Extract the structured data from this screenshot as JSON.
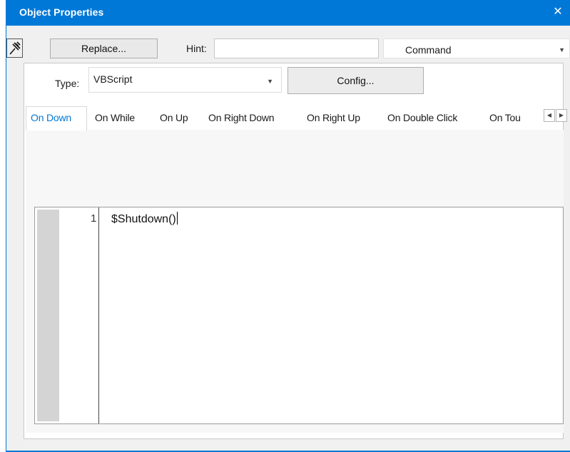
{
  "window": {
    "title": "Object Properties",
    "close_glyph": "✕"
  },
  "toolbar": {
    "pin_icon": "pin-icon",
    "replace_label": "Replace...",
    "hint_label": "Hint:",
    "hint_value": "",
    "command_value": "Command"
  },
  "type_row": {
    "type_label": "Type:",
    "type_value": "VBScript",
    "config_label": "Config..."
  },
  "tabs": [
    {
      "label": "On Down",
      "active": true
    },
    {
      "label": "On While",
      "active": false
    },
    {
      "label": "On Up",
      "active": false
    },
    {
      "label": "On Right Down",
      "active": false
    },
    {
      "label": "On Right Up",
      "active": false
    },
    {
      "label": "On Double Click",
      "active": false
    },
    {
      "label": "On Tou",
      "active": false
    }
  ],
  "tab_scroll": {
    "left": "◀",
    "right": "▶"
  },
  "editor": {
    "line_number": "1",
    "code": "$Shutdown()"
  },
  "colors": {
    "accent": "#0078d7",
    "gutter": "#d4d4d4"
  }
}
